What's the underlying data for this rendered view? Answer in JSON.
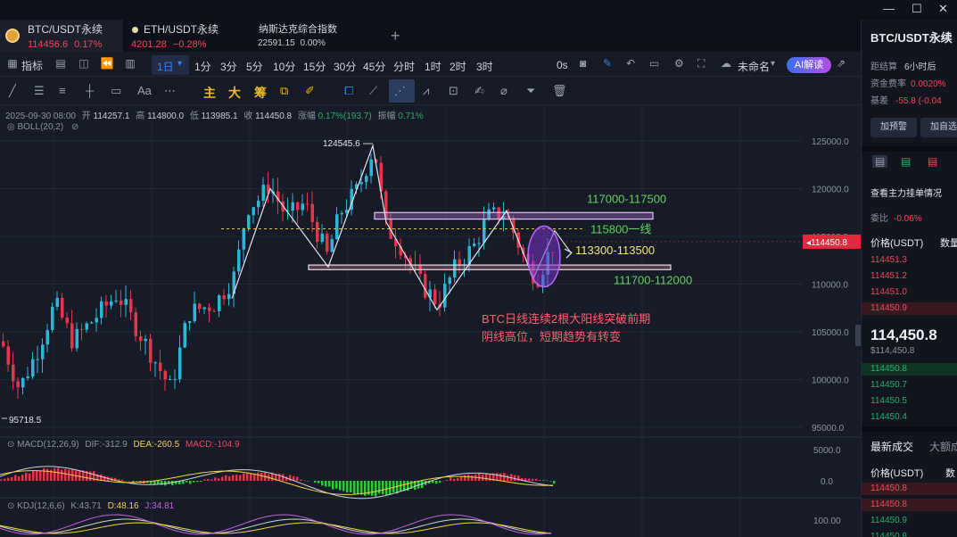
{
  "window_controls": {
    "minimize": "—",
    "maximize": "☐",
    "close": "✕"
  },
  "tabs": [
    {
      "name": "BTC/USDT永续",
      "price": "114456.6",
      "change": "0.17%"
    },
    {
      "name": "ETH/USDT永续",
      "price": "4201.28",
      "change": "−0.28%"
    },
    {
      "name": "纳斯达克综合指数",
      "price": "22591.15",
      "change": "0.00%"
    }
  ],
  "add_tab": "+",
  "toolbar": {
    "indicators": "指标",
    "active_timeframe": "1日",
    "timeframes": [
      "1分",
      "3分",
      "5分",
      "10分",
      "15分",
      "30分",
      "45分",
      "分时",
      "1时",
      "2时",
      "3时"
    ],
    "replay": "0s",
    "layout_name": "未命名",
    "ai_button": "AI解读"
  },
  "drawing_toolbar": {
    "chars": [
      "主",
      "大",
      "筹"
    ],
    "text_tool": "Aa"
  },
  "info_bar": {
    "date": "2025-09-30 08:00",
    "open_label": "开",
    "open": "114257.1",
    "high_label": "高",
    "high": "114800.0",
    "low_label": "低",
    "low": "113985.1",
    "close_label": "收",
    "close": "114450.8",
    "change_label": "涨幅",
    "change": "0.17%(193.7)",
    "amp_label": "振幅",
    "amp": "0.71%"
  },
  "boll_label": "BOLL(20,2)",
  "price_axis": [
    "125000.0",
    "120000.0",
    "115000.0",
    "110000.0",
    "105000.0",
    "100000.0",
    "95000.0"
  ],
  "current_price": "114450.8",
  "high_marker": "124545.6",
  "low_marker": "95718.5",
  "levels": [
    {
      "label": "117000-117500",
      "color": "#5fd35f"
    },
    {
      "label": "115800一线",
      "color": "#5fd35f"
    },
    {
      "label": "113300-113500",
      "color": "#f3e47a"
    },
    {
      "label": "111700-112000",
      "color": "#5fd35f"
    }
  ],
  "annotation": {
    "line1": "BTC日线连续2根大阳线突破前期",
    "line2": "阴线高位，短期趋势有转变",
    "color": "#ff6070"
  },
  "macd": {
    "label": "MACD(12,26,9)",
    "dif": "DIF:-312.9",
    "dea": "DEA:-260.5",
    "macd": "MACD:-104.9",
    "axis": [
      "5000.0",
      "0.0"
    ]
  },
  "kdj": {
    "label": "KDJ(12,6,6)",
    "k": "K:43.71",
    "d": "D:48.16",
    "j": "J:34.81",
    "axis": [
      "100.00"
    ]
  },
  "sidebar": {
    "title": "BTC/USDT永续",
    "settlement_label": "距结算",
    "settlement_value": "6小时后",
    "funding_label": "资金费率",
    "funding_value": "0.0020%",
    "basis_label": "基差",
    "basis_value": "-55.8 (-0.04",
    "btn_alert": "加预警",
    "btn_add": "加自选",
    "depth_link": "查看主力挂单情况",
    "ratio_label": "委比",
    "ratio_value": "-0.06%",
    "price_header": "价格(USDT)",
    "qty_header": "数量",
    "asks": [
      "114451.3",
      "114451.2",
      "114451.0",
      "114450.9"
    ],
    "last_price": "114,450.8",
    "last_price_usd": "$114,450.8",
    "bids": [
      "114450.8",
      "114450.7",
      "114450.5",
      "114450.4"
    ],
    "trades_title": "最新成交",
    "trades_tab2": "大额成",
    "trades_price_header": "价格(USDT)",
    "trades_qty_header": "数",
    "trades": [
      {
        "price": "114450.8",
        "side": "sell"
      },
      {
        "price": "114450.8",
        "side": "sell"
      },
      {
        "price": "114450.9",
        "side": "buy"
      },
      {
        "price": "114450.8",
        "side": "buy"
      }
    ]
  }
}
